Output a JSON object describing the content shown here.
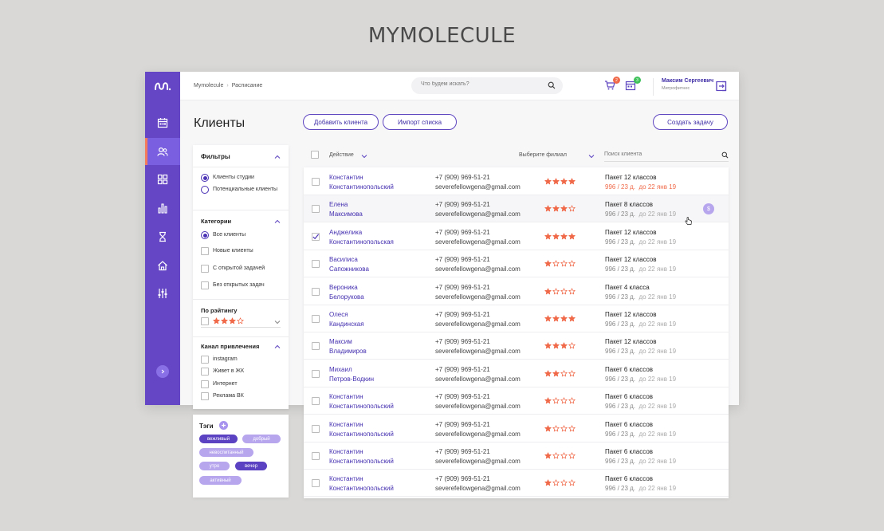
{
  "brand": "MYMOLECULE",
  "breadcrumb": {
    "home": "Mymolecule",
    "separator": "›",
    "current": "Расписание"
  },
  "search": {
    "placeholder": "Что будем искать?"
  },
  "notifications": {
    "cart_count": "2",
    "calendar_count": "3"
  },
  "user": {
    "name": "Максим Сергеевич",
    "org": "Митрофитнес"
  },
  "page": {
    "title": "Клиенты"
  },
  "actions": {
    "add_client": "Добавить клиента",
    "import_list": "Импорт списка",
    "create_task": "Создать задачу"
  },
  "sidebar": {
    "items": [
      {
        "icon": "calendar-icon"
      },
      {
        "icon": "users-icon",
        "active": true
      },
      {
        "icon": "grid-icon"
      },
      {
        "icon": "bar-chart-icon"
      },
      {
        "icon": "hourglass-icon"
      },
      {
        "icon": "home-icon"
      },
      {
        "icon": "sliders-icon"
      }
    ]
  },
  "filters": {
    "title": "Фильтры",
    "client_type": [
      {
        "label": "Клиенты студии",
        "selected": true
      },
      {
        "label": "Потенциальные клиенты",
        "selected": false
      }
    ],
    "categories_title": "Категории",
    "categories": [
      {
        "label": "Все клиенты",
        "selected": true
      },
      {
        "label": "Новые клиенты",
        "selected": false
      },
      {
        "label": "С открытой задачей",
        "selected": false
      },
      {
        "label": "Без открытых задач",
        "selected": false
      }
    ],
    "rating_title": "По рэйтингу",
    "rating_value": 3,
    "channel_title": "Канал привлечения",
    "channels": [
      {
        "label": "instagram"
      },
      {
        "label": "Живет в ЖК"
      },
      {
        "label": "Интернет"
      },
      {
        "label": "Реклама ВК"
      }
    ]
  },
  "tags": {
    "title": "Тэги",
    "items": [
      {
        "label": "вежливый",
        "dark": true
      },
      {
        "label": "добрый",
        "dark": false
      },
      {
        "label": "невоспитанный",
        "dark": false
      },
      {
        "label": "утро",
        "dark": false
      },
      {
        "label": "вечер",
        "dark": true
      },
      {
        "label": "активный",
        "dark": false
      }
    ]
  },
  "toolbar": {
    "action": "Действие",
    "branch": "Выберите филиал",
    "client_search": "Поиск клиента"
  },
  "colors": {
    "accent": "#5e45c0",
    "sidebar": "#6546c4",
    "star": "#f06a4a",
    "warn": "#f06a4a"
  },
  "clients": [
    {
      "first": "Константин",
      "last": "Константинопольский",
      "phone": "+7 (909) 969-51-21",
      "email": "severefellowgena@gmail.com",
      "rating": 4,
      "package": "Пакет 12 классов",
      "sessions": "996 / 23 д.",
      "until": "до 22 янв 19",
      "warn": true,
      "checked": false
    },
    {
      "first": "Елена",
      "last": "Максимова",
      "phone": "+7 (909) 969-51-21",
      "email": "severefellowgena@gmail.com",
      "rating": 3,
      "package": "Пакет 8 классов",
      "sessions": "996 / 23 д.",
      "until": "до 22 янв 19",
      "warn": false,
      "checked": false
    },
    {
      "first": "Анджелика",
      "last": "Константинопольская",
      "phone": "+7 (909) 969-51-21",
      "email": "severefellowgena@gmail.com",
      "rating": 4,
      "package": "Пакет 12 классов",
      "sessions": "996 / 23 д.",
      "until": "до 22 янв 19",
      "warn": false,
      "checked": true
    },
    {
      "first": "Василиса",
      "last": "Сапожникова",
      "phone": "+7 (909) 969-51-21",
      "email": "severefellowgena@gmail.com",
      "rating": 1,
      "package": "Пакет 12 классов",
      "sessions": "996 / 23 д.",
      "until": "до 22 янв 19",
      "warn": false,
      "checked": false
    },
    {
      "first": "Вероника",
      "last": "Белорукова",
      "phone": "+7 (909) 969-51-21",
      "email": "severefellowgena@gmail.com",
      "rating": 1,
      "package": "Пакет 4 класса",
      "sessions": "996 / 23 д.",
      "until": "до 22 янв 19",
      "warn": false,
      "checked": false
    },
    {
      "first": "Олеся",
      "last": "Кандинская",
      "phone": "+7 (909) 969-51-21",
      "email": "severefellowgena@gmail.com",
      "rating": 4,
      "package": "Пакет 12 классов",
      "sessions": "996 / 23 д.",
      "until": "до 22 янв 19",
      "warn": false,
      "checked": false
    },
    {
      "first": "Максим",
      "last": "Владимиров",
      "phone": "+7 (909) 969-51-21",
      "email": "severefellowgena@gmail.com",
      "rating": 3,
      "package": "Пакет 12 классов",
      "sessions": "996 / 23 д.",
      "until": "до 22 янв 19",
      "warn": false,
      "checked": false
    },
    {
      "first": "Михаил",
      "last": "Петров-Водкин",
      "phone": "+7 (909) 969-51-21",
      "email": "severefellowgena@gmail.com",
      "rating": 2,
      "package": "Пакет 6 классов",
      "sessions": "996 / 23 д.",
      "until": "до 22 янв 19",
      "warn": false,
      "checked": false
    },
    {
      "first": "Константин",
      "last": "Константинопольский",
      "phone": "+7 (909) 969-51-21",
      "email": "severefellowgena@gmail.com",
      "rating": 1,
      "package": "Пакет 6 классов",
      "sessions": "996 / 23 д.",
      "until": "до 22 янв 19",
      "warn": false,
      "checked": false
    },
    {
      "first": "Константин",
      "last": "Константинопольский",
      "phone": "+7 (909) 969-51-21",
      "email": "severefellowgena@gmail.com",
      "rating": 1,
      "package": "Пакет 6 классов",
      "sessions": "996 / 23 д.",
      "until": "до 22 янв 19",
      "warn": false,
      "checked": false
    },
    {
      "first": "Константин",
      "last": "Константинопольский",
      "phone": "+7 (909) 969-51-21",
      "email": "severefellowgena@gmail.com",
      "rating": 1,
      "package": "Пакет 6 классов",
      "sessions": "996 / 23 д.",
      "until": "до 22 янв 19",
      "warn": false,
      "checked": false
    },
    {
      "first": "Константин",
      "last": "Константинопольский",
      "phone": "+7 (909) 969-51-21",
      "email": "severefellowgena@gmail.com",
      "rating": 1,
      "package": "Пакет 6 классов",
      "sessions": "996 / 23 д.",
      "until": "до 22 янв 19",
      "warn": false,
      "checked": false
    }
  ]
}
